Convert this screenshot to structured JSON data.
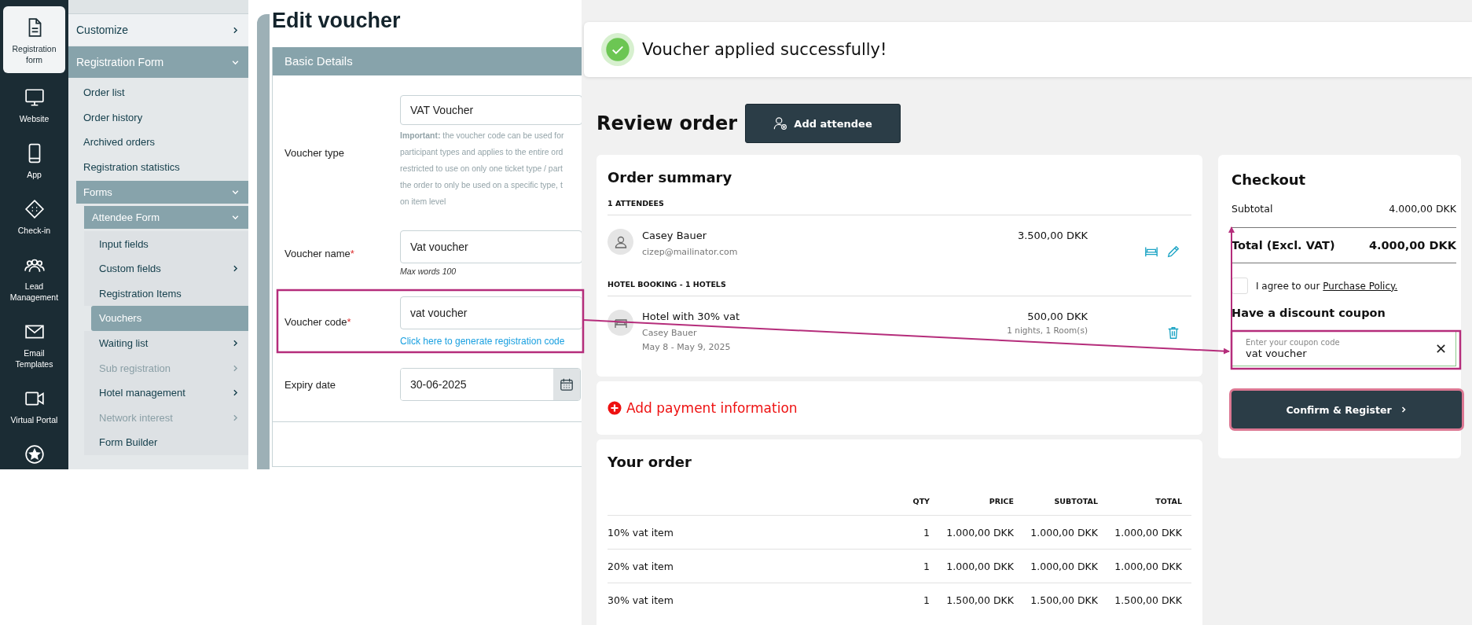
{
  "rail": [
    {
      "label": "Registration form",
      "selected": true
    },
    {
      "label": "Website",
      "selected": false
    },
    {
      "label": "App",
      "selected": false
    },
    {
      "label": "Check-in",
      "selected": false
    },
    {
      "label": "Lead Management",
      "selected": false
    },
    {
      "label": "Email Templates",
      "selected": false
    },
    {
      "label": "Virtual Portal",
      "selected": false
    },
    {
      "selected": false
    }
  ],
  "sidebar": [
    {
      "label": "Customize",
      "expanded": false
    },
    {
      "label": "Registration Form",
      "expanded": true,
      "children": [
        {
          "label": "Order list",
          "selected": false
        },
        {
          "label": "Order history",
          "selected": false
        },
        {
          "label": "Archived orders",
          "selected": false
        },
        {
          "label": "Registration statistics",
          "selected": false
        },
        {
          "label": "Forms",
          "expanded": true,
          "children": [
            {
              "label": "Attendee Form",
              "expanded": true,
              "children": [
                {
                  "label": "Input fields",
                  "selected": false,
                  "disabled": false
                },
                {
                  "label": "Custom fields",
                  "selected": false,
                  "disabled": false,
                  "expanded": false
                },
                {
                  "label": "Registration Items",
                  "selected": false,
                  "disabled": false
                },
                {
                  "label": "Vouchers",
                  "selected": true,
                  "disabled": false
                },
                {
                  "label": "Waiting list",
                  "selected": false,
                  "disabled": false,
                  "expanded": false
                },
                {
                  "label": "Sub registration",
                  "selected": false,
                  "disabled": true,
                  "expanded": false
                },
                {
                  "label": "Hotel management",
                  "selected": false,
                  "disabled": false,
                  "expanded": false
                },
                {
                  "label": "Network interest",
                  "selected": false,
                  "disabled": true,
                  "expanded": false
                },
                {
                  "label": "Form Builder",
                  "selected": false,
                  "disabled": false
                }
              ]
            }
          ]
        }
      ]
    }
  ],
  "form": {
    "title": "Edit voucher",
    "section": "Basic Details",
    "fields": [
      {
        "kind": "text",
        "label": "Voucher type",
        "value": "VAT Voucher",
        "note_lines": [
          "**Important:** the voucher code can be used for",
          "participant types and applies to the entire ord",
          "restricted to use on only one ticket type / part",
          "the order to only be used on a specific type, t",
          "on item level"
        ]
      },
      {
        "kind": "text",
        "label": "Voucher name",
        "required_mark": "*",
        "value": "Vat voucher",
        "hint": "Max words 100"
      },
      {
        "kind": "text",
        "label": "Voucher code",
        "required_mark": "*",
        "value": "vat voucher",
        "link": "Click here to generate registration code"
      },
      {
        "kind": "date",
        "label": "Expiry date",
        "value": "30-06-2025"
      }
    ]
  },
  "toast": {
    "kind": "success",
    "message": "Voucher applied successfully!"
  },
  "review": {
    "title": "Review order",
    "add_button": "Add attendee"
  },
  "order_summary": {
    "title": "Order summary",
    "sections": [
      {
        "kind": "attendee",
        "heading": "1 ATTENDEES",
        "entries": [
          {
            "name": "Casey Bauer",
            "lines": [
              "cizep@mailinator.com"
            ],
            "price": "3.500,00 DKK"
          }
        ]
      },
      {
        "kind": "hotel",
        "heading": "HOTEL BOOKING - 1 HOTELS",
        "entries": [
          {
            "name": "Hotel with 30% vat",
            "lines": [
              "Casey Bauer",
              "May 8 - May 9, 2025"
            ],
            "price": "500,00 DKK",
            "price_note": "1 nights, 1 Room(s)"
          }
        ]
      }
    ]
  },
  "payment": {
    "label": "Add payment information"
  },
  "your_order": {
    "title": "Your order",
    "columns": [
      "QTY",
      "PRICE",
      "SUBTOTAL",
      "TOTAL"
    ],
    "rows": [
      {
        "item": "10% vat item",
        "cells": [
          "1",
          "1.000,00 DKK",
          "1.000,00 DKK",
          "1.000,00 DKK"
        ]
      },
      {
        "item": "20% vat item",
        "cells": [
          "1",
          "1.000,00 DKK",
          "1.000,00 DKK",
          "1.000,00 DKK"
        ]
      },
      {
        "item": "30% vat item",
        "cells": [
          "1",
          "1.500,00 DKK",
          "1.500,00 DKK",
          "1.500,00 DKK"
        ]
      }
    ]
  },
  "checkout": {
    "title": "Checkout",
    "subtotal_label": "Subtotal",
    "subtotal": "4.000,00 DKK",
    "total_label": "Total (Excl. VAT)",
    "total": "4.000,00 DKK",
    "agree_checked": false,
    "agree_text": "I agree to our",
    "policy_link": "Purchase Policy.",
    "coupon_heading": "Have a discount coupon",
    "coupon_label": "Enter your coupon code",
    "coupon_value": "vat voucher",
    "confirm_button": "Confirm & Register"
  }
}
